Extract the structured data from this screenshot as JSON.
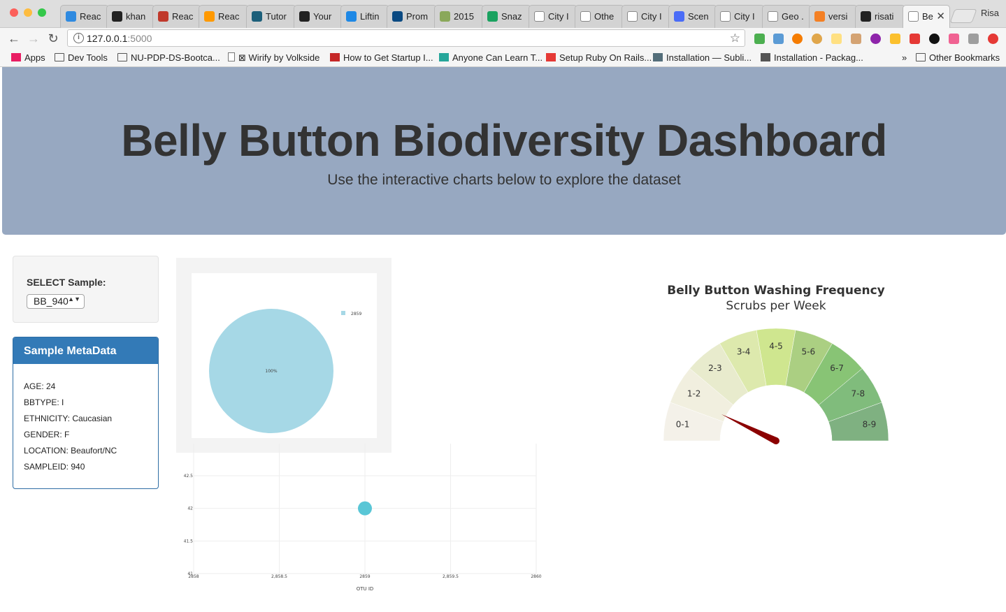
{
  "browser": {
    "tabs": [
      {
        "label": "Reac",
        "color": "#2f8ae0"
      },
      {
        "label": "khan",
        "color": "#222222"
      },
      {
        "label": "Reac",
        "color": "#c0392b"
      },
      {
        "label": "Reac",
        "color": "#ff9900"
      },
      {
        "label": "Tutor",
        "color": "#1c5f7a"
      },
      {
        "label": "Your",
        "color": "#222222"
      },
      {
        "label": "Liftin",
        "color": "#1e88e5"
      },
      {
        "label": "Prom",
        "color": "#0b4a82"
      },
      {
        "label": "2015",
        "color": "#8aa85a"
      },
      {
        "label": "Snaz",
        "color": "#1aa260"
      },
      {
        "label": "City I",
        "color": "#ffffff"
      },
      {
        "label": "Othe",
        "color": "#ffffff"
      },
      {
        "label": "City I",
        "color": "#ffffff"
      },
      {
        "label": "Scen",
        "color": "#4a6cf7"
      },
      {
        "label": "City I",
        "color": "#ffffff"
      },
      {
        "label": "Geo .",
        "color": "#ffffff"
      },
      {
        "label": "versi",
        "color": "#f48024"
      },
      {
        "label": "risati",
        "color": "#222222"
      },
      {
        "label": "Be",
        "color": "#ffffff"
      }
    ],
    "profile": "Risa",
    "url_host": "127.0.0.1",
    "url_port": ":5000",
    "info_glyph": "i",
    "back_icon": "←",
    "forward_icon": "→",
    "reload_icon": "↻",
    "star_icon": "☆",
    "tab_close_icon": "✕",
    "bookmarks": [
      {
        "label": "Apps",
        "icon": "apps"
      },
      {
        "label": "Dev Tools",
        "icon": "folder"
      },
      {
        "label": "NU-PDP-DS-Bootca...",
        "icon": "folder"
      },
      {
        "label": "⊠ Wirify by Volkside",
        "icon": "page"
      },
      {
        "label": "How to Get Startup I...",
        "icon": "yc"
      },
      {
        "label": "Anyone Can Learn T...",
        "icon": "brace"
      },
      {
        "label": "Setup Ruby On Rails...",
        "icon": "rails"
      },
      {
        "label": "Installation — Subli...",
        "icon": "grid"
      },
      {
        "label": "Installation - Packag...",
        "icon": "box"
      }
    ],
    "more_bookmarks": "»",
    "other_bookmarks": "Other Bookmarks"
  },
  "header": {
    "title": "Belly Button Biodiversity Dashboard",
    "subtitle": "Use the interactive charts below to explore the dataset"
  },
  "selector": {
    "label": "SELECT Sample:",
    "selected": "BB_940",
    "arrows": "▲▼"
  },
  "metadata": {
    "heading": "Sample MetaData",
    "rows": [
      "AGE: 24",
      "BBTYPE: I",
      "ETHNICITY: Caucasian",
      "GENDER: F",
      "LOCATION: Beaufort/NC",
      "SAMPLEID: 940"
    ]
  },
  "chart_data": [
    {
      "type": "pie",
      "labels": [
        "2859"
      ],
      "values": [
        100
      ],
      "slice_labels": [
        "100%"
      ],
      "legend": [
        "2859"
      ],
      "colors": [
        "#a6d8e6"
      ]
    },
    {
      "type": "scatter",
      "xlabel": "OTU ID",
      "x": [
        2859
      ],
      "y": [
        42
      ],
      "xlim": [
        2858,
        2860
      ],
      "ylim": [
        41,
        43
      ],
      "xticks": [
        2858,
        2858.5,
        2859,
        2859.5,
        2860
      ],
      "xtick_labels": [
        "2858",
        "2,858.5",
        "2859",
        "2,859.5",
        "2860"
      ],
      "yticks": [
        41,
        41.5,
        42,
        42.5
      ],
      "ytick_labels": [
        "41",
        "41.5",
        "42",
        "42.5"
      ],
      "color": "#59c6d6",
      "grid": true
    },
    {
      "type": "gauge",
      "title": "Belly Button Washing Frequency",
      "subtitle": "Scrubs per Week",
      "categories": [
        "0-1",
        "1-2",
        "2-3",
        "3-4",
        "4-5",
        "5-6",
        "6-7",
        "7-8",
        "8-9"
      ],
      "colors": [
        "#f4f1e9",
        "#f1efdf",
        "#e8ebcd",
        "#dde9ad",
        "#cfe68f",
        "#abcf82",
        "#88c475",
        "#80bc7c",
        "#7fb181"
      ],
      "value": 1.3,
      "range": [
        0,
        9
      ],
      "needle_color": "#8b0000"
    }
  ]
}
